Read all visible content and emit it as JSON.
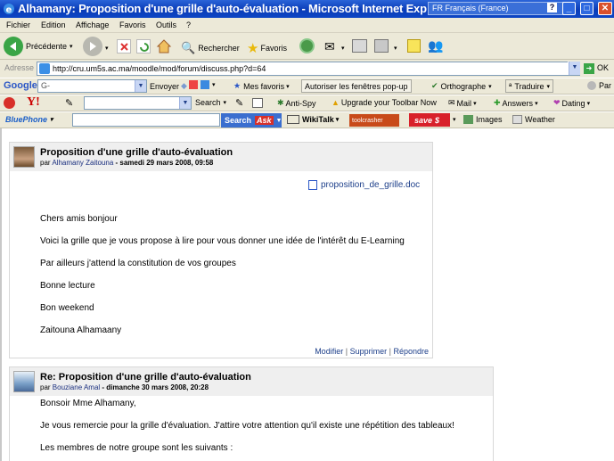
{
  "window": {
    "title": "Alhamany: Proposition d'une grille d'auto-évaluation - Microsoft Internet Exp",
    "language": "FR Français (France)"
  },
  "menu": [
    "Fichier",
    "Edition",
    "Affichage",
    "Favoris",
    "Outils",
    "?"
  ],
  "toolbar": {
    "back": "Précédente",
    "search": "Rechercher",
    "favorites": "Favoris"
  },
  "address": {
    "label": "Adresse",
    "url": "http://cru.um5s.ac.ma/moodle/mod/forum/discuss.php?d=64",
    "go": "OK"
  },
  "google_bar": {
    "logo": "Google",
    "search_value": "G-",
    "envoyer": "Envoyer",
    "favoris": "Mes favoris",
    "popups": "Autoriser les fenêtres pop-up",
    "spell": "Orthographe",
    "translate": "Traduire",
    "par": "Par"
  },
  "yahoo_bar": {
    "search": "Search",
    "antispy": "Anti-Spy",
    "upgrade": "Upgrade your Toolbar Now",
    "mail": "Mail",
    "answers": "Answers",
    "dating": "Dating"
  },
  "bluephone_bar": {
    "logo": "BluePhone",
    "search_btn": "Search",
    "ask": "Ask",
    "wikitalk": "WikiTalk",
    "crasher": "toolcrasher",
    "save": "save",
    "images": "Images",
    "weather": "Weather"
  },
  "post1": {
    "subject": "Proposition d'une grille d'auto-évaluation",
    "by": "par",
    "author": "Alhamany Zaitouna",
    "date": "- samedi 29 mars 2008, 09:58",
    "attachment": "proposition_de_grille.doc",
    "lines": [
      "Chers amis bonjour",
      "Voici la grille que je vous propose à lire pour vous donner une idée de l'intérêt du E-Learning",
      "Par ailleurs j'attend  la constitution de vos groupes",
      " Bonne lecture",
      "Bon weekend",
      " Zaitouna Alhamaany"
    ],
    "actions": [
      "Modifier",
      "Supprimer",
      "Répondre"
    ],
    "sep": "|"
  },
  "post2": {
    "subject": "Re: Proposition d'une grille d'auto-évaluation",
    "by": "par",
    "author": "Bouziane Amal",
    "date": "- dimanche 30 mars 2008, 20:28",
    "lines": [
      "Bonsoir Mme Alhamany,",
      "Je vous remercie pour la grille d'évaluation. J'attire votre attention qu'il existe une répétition des tableaux!",
      "Les membres de notre groupe sont les suivants :"
    ]
  }
}
